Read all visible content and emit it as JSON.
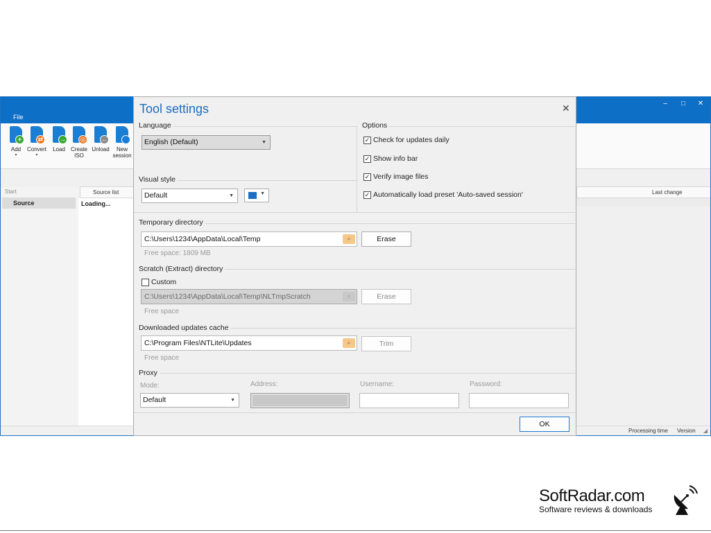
{
  "app": {
    "menu_file": "File",
    "window_controls": {
      "minimize": "–",
      "maximize": "□",
      "close": "✕"
    },
    "ribbon": [
      {
        "label": "Add",
        "arrow": "▾",
        "badge": "+",
        "badge_color": "#3aa935",
        "icon": "add-icon"
      },
      {
        "label": "Convert",
        "arrow": "▾",
        "badge": "⇄",
        "badge_color": "#e87722",
        "icon": "convert-icon"
      },
      {
        "label": "Load",
        "arrow": "",
        "badge": "→",
        "badge_color": "#3aa935",
        "icon": "load-icon"
      },
      {
        "label": "Create ISO",
        "arrow": "",
        "badge": "◎",
        "badge_color": "#e87722",
        "icon": "create-iso-icon"
      },
      {
        "label": "Unload",
        "arrow": "",
        "badge": "←",
        "badge_color": "#8a8a8a",
        "icon": "unload-icon"
      },
      {
        "label": "New session",
        "arrow": "",
        "badge": "",
        "badge_color": "#1a7fd4",
        "icon": "new-session-icon"
      }
    ],
    "left_header": "Start",
    "left_item": "Source",
    "list_header": "Source list",
    "list_status": "Loading...",
    "right_header": "Last change",
    "status_processing": "Processing time",
    "status_version": "Version"
  },
  "dialog": {
    "title": "Tool settings",
    "close": "✕",
    "language": {
      "label": "Language",
      "value": "English (Default)"
    },
    "visual_style": {
      "label": "Visual style",
      "value": "Default",
      "accent_color": "#1b6ec2"
    },
    "options": {
      "label": "Options",
      "items": [
        {
          "label": "Check for updates daily",
          "checked": true
        },
        {
          "label": "Show info bar",
          "checked": true
        },
        {
          "label": "Verify image files",
          "checked": true
        },
        {
          "label": "Automatically load preset 'Auto-saved session'",
          "checked": true
        }
      ]
    },
    "temp_dir": {
      "label": "Temporary directory",
      "path": "C:\\Users\\1234\\AppData\\Local\\Temp",
      "free_space": "Free space: 1809 MB",
      "button": "Erase"
    },
    "scratch_dir": {
      "label": "Scratch (Extract) directory",
      "custom_label": "Custom",
      "custom_checked": false,
      "path": "C:\\Users\\1234\\AppData\\Local\\Temp\\NLTmpScratch",
      "free_space": "Free space",
      "button": "Erase"
    },
    "updates_cache": {
      "label": "Downloaded updates cache",
      "path": "C:\\Program Files\\NTLite\\Updates",
      "free_space": "Free space",
      "button": "Trim"
    },
    "proxy": {
      "label": "Proxy",
      "mode_label": "Mode:",
      "mode_value": "Default",
      "address_label": "Address:",
      "username_label": "Username:",
      "password_label": "Password:"
    },
    "ok_button": "OK"
  },
  "watermark": {
    "name": "SoftRadar.com",
    "tagline": "Software reviews & downloads"
  }
}
